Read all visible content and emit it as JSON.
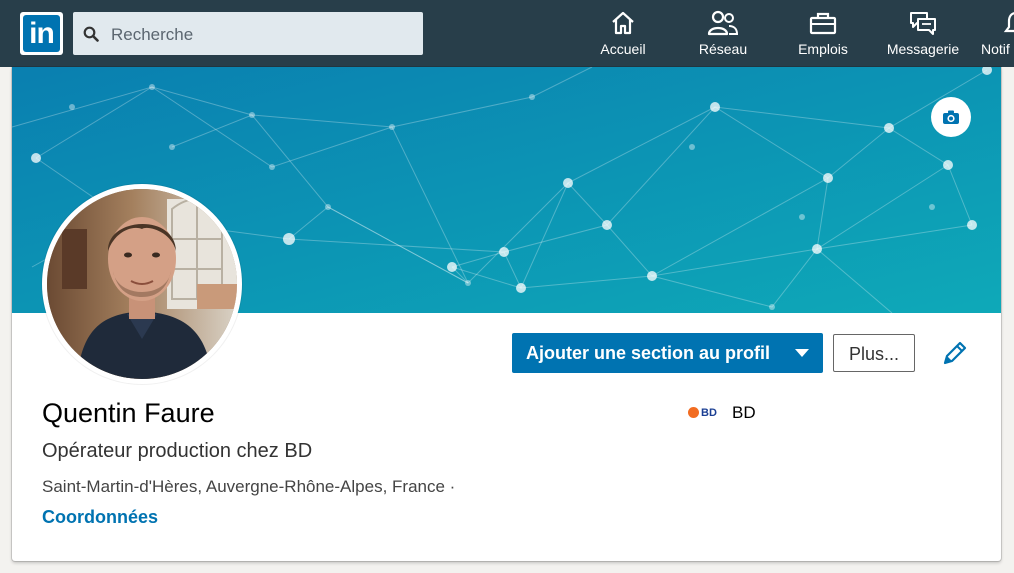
{
  "topbar": {
    "logo_text": "in",
    "search": {
      "placeholder": "Recherche",
      "value": ""
    },
    "nav": [
      {
        "label": "Accueil",
        "icon": "home-icon"
      },
      {
        "label": "Réseau",
        "icon": "network-icon"
      },
      {
        "label": "Emplois",
        "icon": "briefcase-icon"
      },
      {
        "label": "Messagerie",
        "icon": "messaging-icon"
      },
      {
        "label": "Notif",
        "icon": "bell-icon"
      }
    ]
  },
  "profile": {
    "name": "Quentin Faure",
    "headline": "Opérateur production chez BD",
    "location": "Saint-Martin-d'Hères, Auvergne-Rhône-Alpes, France  ·",
    "contact_link": "Coordonnées",
    "add_section_label": "Ajouter une section au profil",
    "more_label": "Plus...",
    "company_logo_text": "BD",
    "company_name": "BD"
  },
  "colors": {
    "topbar_bg": "#283e4a",
    "brand_blue": "#0073b1",
    "banner_start": "#0a7fb0",
    "banner_end": "#0ea9b8"
  }
}
